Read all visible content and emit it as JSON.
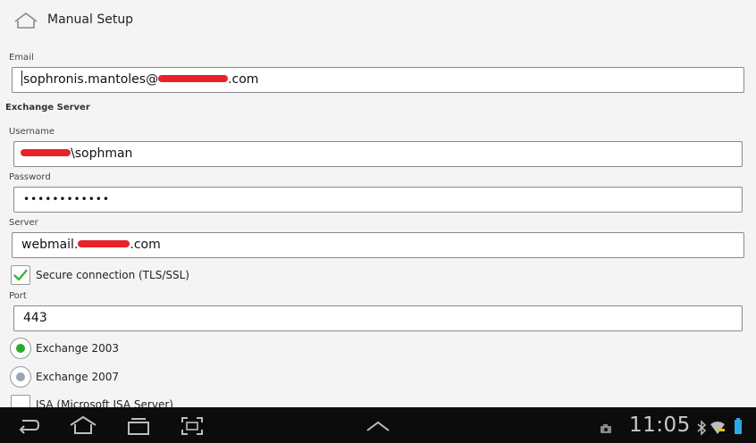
{
  "header": {
    "title": "Manual Setup",
    "icon": "home-icon"
  },
  "email": {
    "label": "Email",
    "value_prefix": "sophronis.mantoles@",
    "value_suffix": ".com"
  },
  "exchange": {
    "section_title": "Exchange Server"
  },
  "username": {
    "label": "Username",
    "value_suffix": "\\sophman"
  },
  "password": {
    "label": "Password",
    "value": "••••••••••••"
  },
  "server": {
    "label": "Server",
    "value_prefix": "webmail.",
    "value_suffix": ".com"
  },
  "secure": {
    "label": "Secure connection (TLS/SSL)",
    "checked": true,
    "check_color": "#3cb33c"
  },
  "port": {
    "label": "Port",
    "value": "443"
  },
  "exchange_versions": [
    {
      "label": "Exchange 2003",
      "selected": true,
      "dot_color": "#2bab2b"
    },
    {
      "label": "Exchange 2007",
      "selected": false,
      "dot_color": "#9aa6b4"
    }
  ],
  "isa": {
    "label": "ISA (Microsoft ISA Server)",
    "checked": false
  },
  "status_bar": {
    "time": "11:05",
    "bg_color": "#0c0c0c"
  },
  "redaction_color": "#e8222a"
}
